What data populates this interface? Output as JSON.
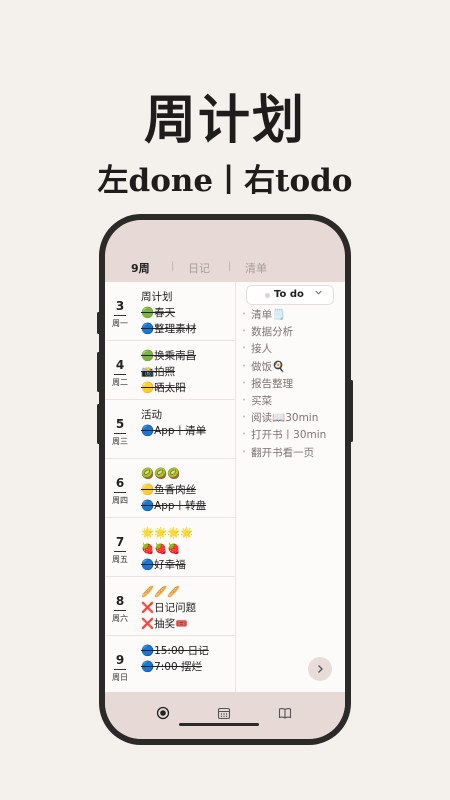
{
  "hero": {
    "title": "周计划",
    "subtitle": "左done丨右todo"
  },
  "tabs": [
    {
      "label": "9周",
      "active": true
    },
    {
      "label": "日记",
      "active": false
    },
    {
      "label": "清单",
      "active": false
    }
  ],
  "days": [
    {
      "num": "3",
      "weekday": "周一",
      "items": [
        {
          "text": "周计划",
          "done": false
        },
        {
          "text": "🟢春天",
          "done": true
        },
        {
          "text": "🔵整理素材",
          "done": true
        }
      ]
    },
    {
      "num": "4",
      "weekday": "周二",
      "items": [
        {
          "text": "🟢换乘南昌",
          "done": true
        },
        {
          "text": "📸拍照",
          "done": true
        },
        {
          "text": "🟡晒太阳",
          "done": true
        }
      ]
    },
    {
      "num": "5",
      "weekday": "周三",
      "items": [
        {
          "text": "活动",
          "done": false
        },
        {
          "text": "🔵App丨清单",
          "done": true
        }
      ]
    },
    {
      "num": "6",
      "weekday": "周四",
      "items": [
        {
          "text": "🥝🥝🥝",
          "done": false
        },
        {
          "text": "🟡鱼香肉丝",
          "done": true
        },
        {
          "text": "🔵App丨转盘",
          "done": true
        }
      ]
    },
    {
      "num": "7",
      "weekday": "周五",
      "items": [
        {
          "text": "🌟🌟🌟🌟",
          "done": false
        },
        {
          "text": "🍓🍓🍓",
          "done": false
        },
        {
          "text": "🔵好幸福",
          "done": true
        }
      ]
    },
    {
      "num": "8",
      "weekday": "周六",
      "items": [
        {
          "text": "🥖🥖🥖",
          "done": false
        },
        {
          "text": "❌日记问题",
          "done": false
        },
        {
          "text": "❌抽奖🎟️",
          "done": false
        }
      ]
    },
    {
      "num": "9",
      "weekday": "周日",
      "items": [
        {
          "text": "🔵15:00 日记",
          "done": true
        },
        {
          "text": "🔵7:00 摆烂",
          "done": true
        }
      ]
    }
  ],
  "todo": {
    "header": "To do",
    "items": [
      "清单🗒️",
      "数据分析",
      "接人",
      "做饭🍳",
      "报告整理",
      "买菜",
      "阅读📖30min",
      "打开书丨30min",
      "翻开书看一页"
    ]
  },
  "icons": {
    "fab": "chevron-right-icon",
    "nav": [
      "record-icon",
      "calendar-icon",
      "book-icon"
    ]
  }
}
